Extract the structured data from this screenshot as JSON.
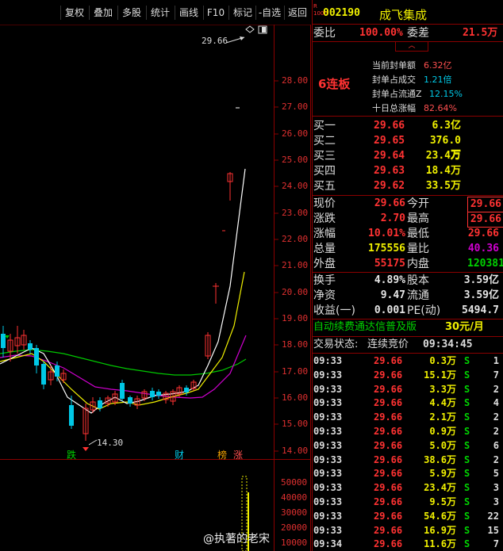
{
  "toolbar": {
    "buttons": [
      "复权",
      "叠加",
      "多股",
      "统计",
      "画线",
      "F10",
      "标记",
      "-自选",
      "返回"
    ]
  },
  "chart": {
    "high_label": "29.66",
    "low_label": "14.30",
    "price_ticks": [
      "28.00",
      "27.00",
      "26.00",
      "25.00",
      "24.00",
      "23.00",
      "22.00",
      "21.00",
      "20.00",
      "19.00",
      "18.00",
      "17.00",
      "16.00",
      "15.00",
      "14.00"
    ],
    "volume_ticks": [
      "50000",
      "40000",
      "30000",
      "20000",
      "10000"
    ],
    "event_tags": [
      "跌",
      "财",
      "榜",
      "涨"
    ]
  },
  "quote": {
    "code": "002190",
    "name": "成飞集成",
    "weibi_label": "委比",
    "weibi_value": "100.00%",
    "weicha_label": "委差",
    "weicha_value": "21.5万",
    "board_label": "6连板",
    "seal": [
      {
        "label": "当前封单额",
        "value": "6.32亿"
      },
      {
        "label": "封单占成交",
        "value": "1.21倍"
      },
      {
        "label": "封单占流通Z",
        "value": "12.15%"
      },
      {
        "label": "十日总涨幅",
        "value": "82.64%"
      }
    ],
    "bids": [
      {
        "label": "买一",
        "price": "29.66",
        "vol": "6.3亿"
      },
      {
        "label": "买二",
        "price": "29.65",
        "vol": "376.0万"
      },
      {
        "label": "买三",
        "price": "29.64",
        "vol": "23.4万"
      },
      {
        "label": "买四",
        "price": "29.63",
        "vol": "18.4万"
      },
      {
        "label": "买五",
        "price": "29.62",
        "vol": "33.5万"
      }
    ],
    "stats": [
      {
        "l1": "现价",
        "v1": "29.66",
        "l2": "今开",
        "v2": "29.66"
      },
      {
        "l1": "涨跌",
        "v1": "2.70",
        "l2": "最高",
        "v2": "29.66"
      },
      {
        "l1": "涨幅",
        "v1": "10.01%",
        "l2": "最低",
        "v2": "29.66"
      },
      {
        "l1": "总量",
        "v1": "175556",
        "l2": "量比",
        "v2": "40.36"
      },
      {
        "l1": "外盘",
        "v1": "55175",
        "l2": "内盘",
        "v2": "120381"
      }
    ],
    "fund": [
      {
        "l1": "换手",
        "v1": "4.89%",
        "l2": "股本",
        "v2": "3.59亿"
      },
      {
        "l1": "净资",
        "v1": "9.47",
        "l2": "流通",
        "v2": "3.59亿"
      },
      {
        "l1": "收益(一)",
        "v1": "0.001",
        "l2": "PE(动)",
        "v2": "5494.7"
      }
    ],
    "ad_text": "自动续费通达信普及版",
    "ad_price": "30元/月",
    "trade_status_label": "交易状态:",
    "trade_status_value": "连续竞价",
    "trade_status_time": "09:34:45"
  },
  "ticks": [
    {
      "time": "09:33",
      "price": "29.66",
      "vol": "0.3万",
      "side": "S",
      "n": "1"
    },
    {
      "time": "09:33",
      "price": "29.66",
      "vol": "15.1万",
      "side": "S",
      "n": "7"
    },
    {
      "time": "09:33",
      "price": "29.66",
      "vol": "3.3万",
      "side": "S",
      "n": "2"
    },
    {
      "time": "09:33",
      "price": "29.66",
      "vol": "4.4万",
      "side": "S",
      "n": "4"
    },
    {
      "time": "09:33",
      "price": "29.66",
      "vol": "2.1万",
      "side": "S",
      "n": "2"
    },
    {
      "time": "09:33",
      "price": "29.66",
      "vol": "0.9万",
      "side": "S",
      "n": "2"
    },
    {
      "time": "09:33",
      "price": "29.66",
      "vol": "5.0万",
      "side": "S",
      "n": "6"
    },
    {
      "time": "09:33",
      "price": "29.66",
      "vol": "38.6万",
      "side": "S",
      "n": "2"
    },
    {
      "time": "09:33",
      "price": "29.66",
      "vol": "5.9万",
      "side": "S",
      "n": "5"
    },
    {
      "time": "09:33",
      "price": "29.66",
      "vol": "23.4万",
      "side": "S",
      "n": "3"
    },
    {
      "time": "09:33",
      "price": "29.66",
      "vol": "9.5万",
      "side": "S",
      "n": "3"
    },
    {
      "time": "09:33",
      "price": "29.66",
      "vol": "54.6万",
      "side": "S",
      "n": "22"
    },
    {
      "time": "09:33",
      "price": "29.66",
      "vol": "16.9万",
      "side": "S",
      "n": "15"
    },
    {
      "time": "09:34",
      "price": "29.66",
      "vol": "11.6万",
      "side": "S",
      "n": "7"
    }
  ],
  "watermark": "@执著的老宋",
  "colors": {
    "up": "#ff3232",
    "down": "#00d200",
    "value_yellow": "#f0f000",
    "grid_red": "#8b0000"
  }
}
